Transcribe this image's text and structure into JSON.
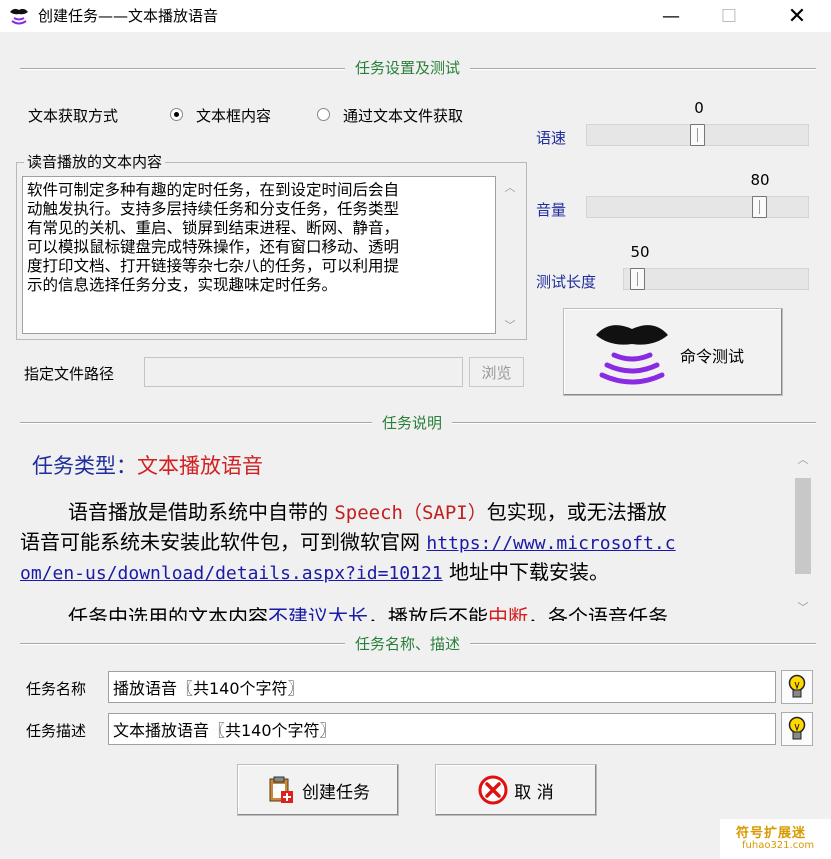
{
  "window": {
    "title": "创建任务——文本播放语音"
  },
  "sections": {
    "settings": "任务设置及测试",
    "description": "任务说明",
    "name_desc": "任务名称、描述"
  },
  "text_source": {
    "label": "文本获取方式",
    "options": [
      {
        "label": "文本框内容",
        "selected": true
      },
      {
        "label": "通过文本文件获取",
        "selected": false
      }
    ]
  },
  "text_content": {
    "group_label": "读音播放的文本内容",
    "value": "软件可制定多种有趣的定时任务，在到设定时间后会自\n动触发执行。支持多层持续任务和分支任务，任务类型\n有常见的关机、重启、锁屏到结束进程、断网、静音，\n可以模拟鼠标键盘完成特殊操作，还有窗口移动、透明\n度打印文档、打开链接等杂七杂八的任务，可以利用提\n示的信息选择任务分支，实现趣味定时任务。"
  },
  "file_path": {
    "label": "指定文件路径",
    "value": "",
    "browse_label": "浏览"
  },
  "sliders": [
    {
      "label": "语速",
      "value": "0",
      "position": 0.5
    },
    {
      "label": "音量",
      "value": "80",
      "position": 0.8
    },
    {
      "label": "测试长度",
      "value": "50",
      "position": 0.06
    }
  ],
  "test_button": {
    "label": "命令测试",
    "icon": "speaking-lips-icon"
  },
  "task_info": {
    "type_prefix": "任务类型：",
    "type_name": "文本播放语音",
    "p1_a": "语音播放是借助系统中自带的 ",
    "p1_speech": "Speech（SAPI）",
    "p1_b": "包实现，或无法播放",
    "p1_c": "语音可能系统未安装此软件包，可到微软官网 ",
    "p1_link_a": "https://www.microsoft.c",
    "p1_link_b": "om/en-us/download/details.aspx?id=10121",
    "p1_d": " 地址中下载安装。",
    "p2_a": "任务中选用的文本内容",
    "p2_red1": "不建议太长",
    "p2_b": "，播放后不能",
    "p2_red2": "中断",
    "p2_c": "，各个语音任务"
  },
  "task_name": {
    "label": "任务名称",
    "value": "播放语音〖共140个字符〗"
  },
  "task_desc": {
    "label": "任务描述",
    "value": "文本播放语音〖共140个字符〗"
  },
  "buttons": {
    "create": "创建任务",
    "cancel": "取 消"
  },
  "watermark": {
    "line1": "符号扩展迷",
    "line2": "fuhao321.com"
  },
  "colors": {
    "section_title": "#2a7f3a",
    "slider_label": "#1f2d9c",
    "task_type_prefix": "#1f2d9c",
    "task_type_name": "#d02020",
    "link": "#1a1aa8",
    "speech": "#c02020"
  }
}
